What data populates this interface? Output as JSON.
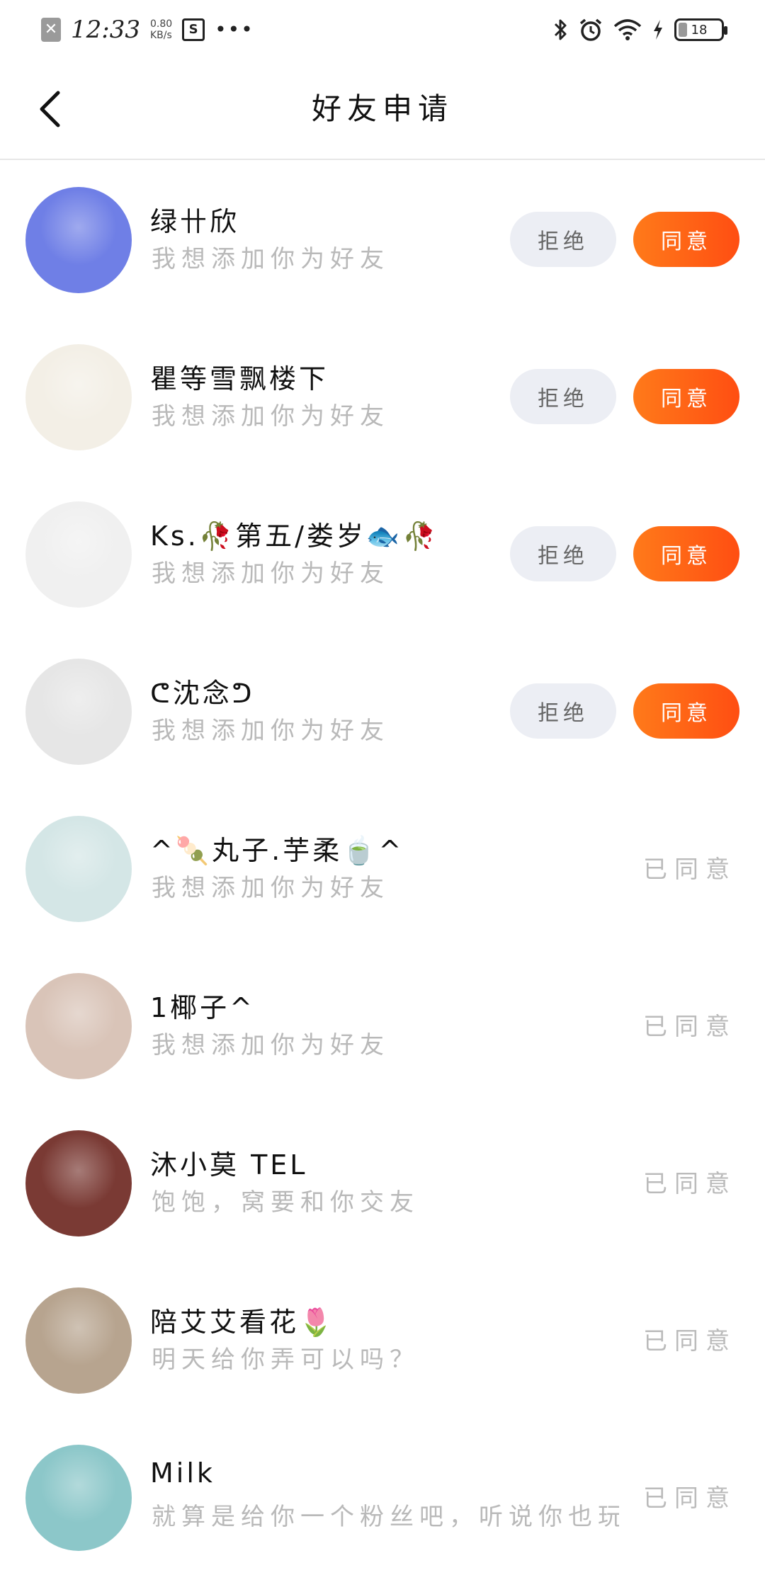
{
  "status_bar": {
    "time": "12:33",
    "speed_value": "0.80",
    "speed_unit": "KB/s",
    "dots": "•••",
    "battery": "18"
  },
  "header": {
    "title": "好友申请"
  },
  "requests": [
    {
      "name": "绿卄欣",
      "message": "我想添加你为好友",
      "reject_label": "拒绝",
      "accept_label": "同意",
      "avatar_color": "#6f7fe6"
    },
    {
      "name": "瞿等雪飘楼下",
      "message": "我想添加你为好友",
      "reject_label": "拒绝",
      "accept_label": "同意",
      "avatar_color": "#f3efe6"
    },
    {
      "name": "Ks.🥀第五/娄岁🐟🥀",
      "message": "我想添加你为好友",
      "reject_label": "拒绝",
      "accept_label": "同意",
      "avatar_color": "#f0f0f0"
    },
    {
      "name": "ᕦ沈念ᕤ",
      "message": "我想添加你为好友",
      "reject_label": "拒绝",
      "accept_label": "同意",
      "avatar_color": "#e6e6e6"
    },
    {
      "name": "^🍡丸子.芋柔🍵^",
      "message": "我想添加你为好友",
      "status": "已同意",
      "avatar_color": "#d4e6e6"
    },
    {
      "name": "1椰子^",
      "message": "我想添加你为好友",
      "status": "已同意",
      "avatar_color": "#d9c4b8"
    },
    {
      "name": "沐小莫 TEL",
      "message": "饱饱，窝要和你交友",
      "status": "已同意",
      "avatar_color": "#7a3a34"
    },
    {
      "name": "陪艾艾看花🌷",
      "message": "明天给你弄可以吗？",
      "status": "已同意",
      "avatar_color": "#b7a48f"
    },
    {
      "name": "Milk",
      "message": "就算是给你一个粉丝吧，听说你也玩逆",
      "status": "已同意",
      "avatar_color": "#8cc7c9"
    }
  ]
}
